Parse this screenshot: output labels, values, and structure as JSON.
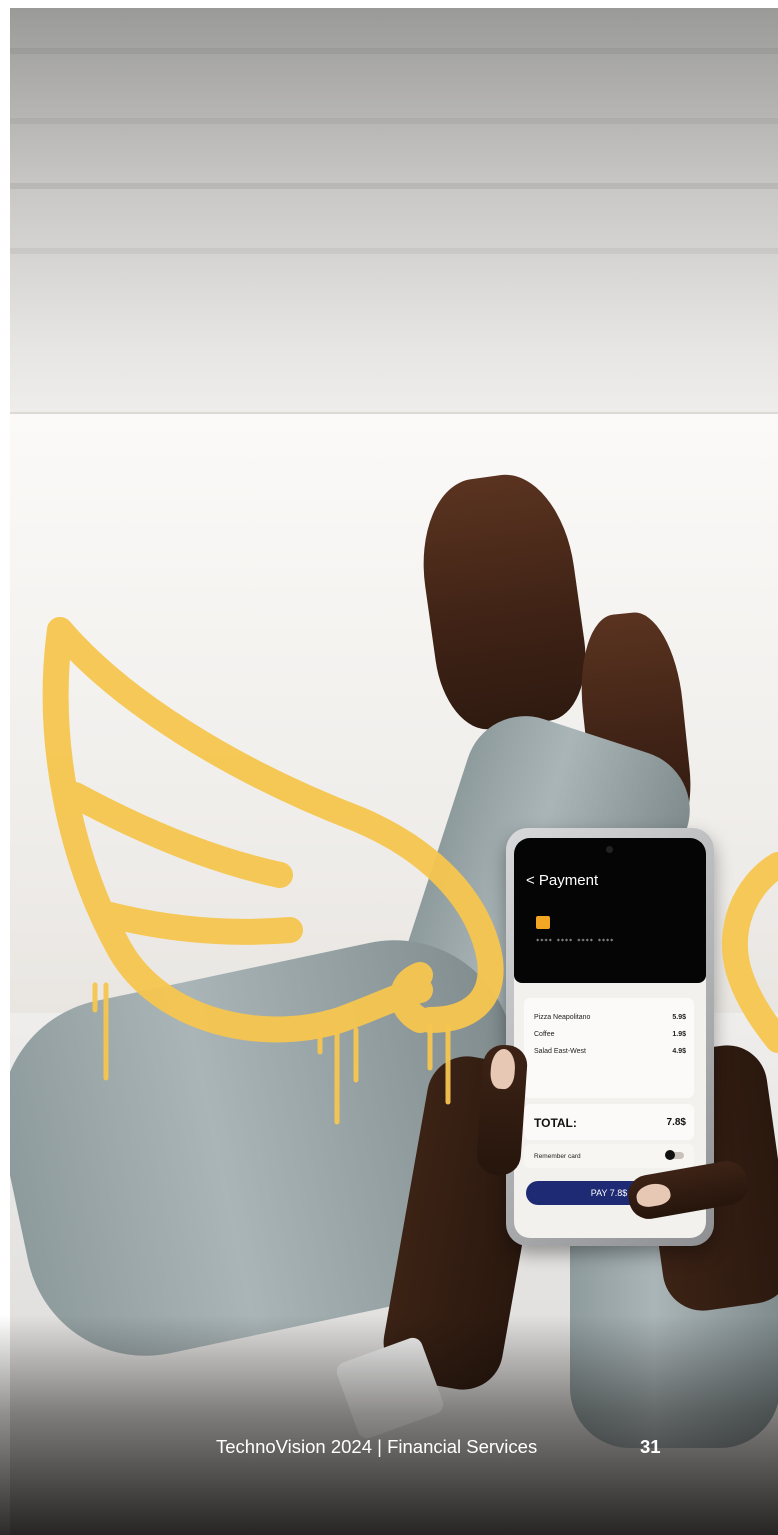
{
  "colors": {
    "accent_yellow": "#f6c64f",
    "pay_button": "#1e2a73",
    "card_chip": "#f2a623",
    "footer_text": "#ffffff"
  },
  "phone": {
    "title": "< Payment",
    "card_number": "**** **** **** ****",
    "items": [
      {
        "name": "Pizza Neapolitano",
        "price": "5.9$"
      },
      {
        "name": "Coffee",
        "price": "1.9$"
      },
      {
        "name": "Salad East-West",
        "price": "4.9$"
      }
    ],
    "total_label": "TOTAL:",
    "total_value": "7.8$",
    "remember_label": "Remember card",
    "pay_button_label": "PAY 7.8$"
  },
  "footer": {
    "text": "TechnoVision 2024 | Financial Services",
    "page_number": "31"
  }
}
